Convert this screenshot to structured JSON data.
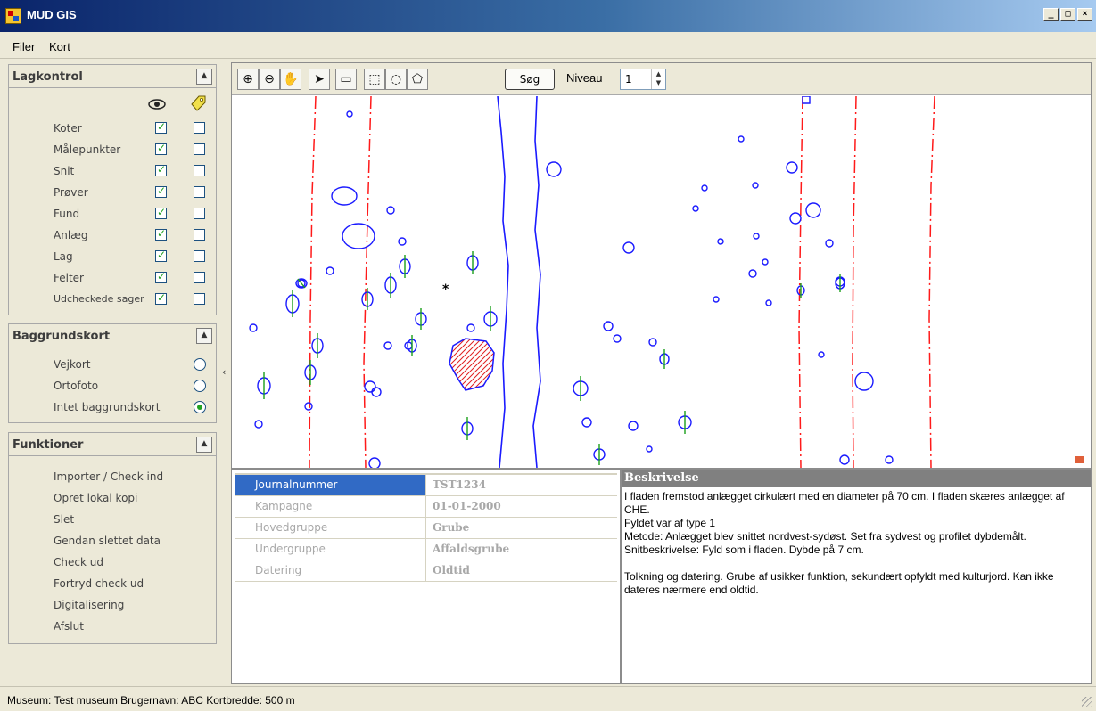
{
  "window": {
    "title": "MUD GIS",
    "buttons": [
      "_",
      "□",
      "×"
    ]
  },
  "menu": {
    "items": [
      "Filer",
      "Kort"
    ]
  },
  "layers_panel": {
    "title": "Lagkontrol",
    "col_visible_icon": "eye-icon",
    "col_label_icon": "tag-icon",
    "rows": [
      {
        "label": "Koter",
        "visible": true,
        "labels": false
      },
      {
        "label": "Målepunkter",
        "visible": true,
        "labels": false
      },
      {
        "label": "Snit",
        "visible": true,
        "labels": false
      },
      {
        "label": "Prøver",
        "visible": true,
        "labels": false
      },
      {
        "label": "Fund",
        "visible": true,
        "labels": false
      },
      {
        "label": "Anlæg",
        "visible": true,
        "labels": false
      },
      {
        "label": "Lag",
        "visible": true,
        "labels": false
      },
      {
        "label": "Felter",
        "visible": true,
        "labels": false
      },
      {
        "label": "Udcheckede sager",
        "visible": true,
        "labels": false
      }
    ]
  },
  "background_panel": {
    "title": "Baggrundskort",
    "options": [
      {
        "label": "Vejkort",
        "selected": false
      },
      {
        "label": "Ortofoto",
        "selected": false
      },
      {
        "label": "Intet baggrundskort",
        "selected": true
      }
    ]
  },
  "functions_panel": {
    "title": "Funktioner",
    "items": [
      "Importer / Check ind",
      "Opret lokal kopi",
      "Slet",
      "Gendan slettet data",
      "Check ud",
      "Fortryd check ud",
      "Digitalisering",
      "Afslut"
    ]
  },
  "toolbar": {
    "tools": [
      "zoom-in-icon",
      "zoom-out-icon",
      "pan-hand-icon",
      "select-arrow-icon",
      "measure-icon",
      "select-rect-icon",
      "select-circle-icon",
      "select-polygon-icon"
    ],
    "search_label": "Søg",
    "level_label": "Niveau",
    "level_value": "1"
  },
  "properties": [
    {
      "key": "Journalnummer",
      "value": "TST1234"
    },
    {
      "key": "Kampagne",
      "value": "01-01-2000"
    },
    {
      "key": "Hovedgruppe",
      "value": "Grube"
    },
    {
      "key": "Undergruppe",
      "value": "Affaldsgrube"
    },
    {
      "key": "Datering",
      "value": "Oldtid"
    }
  ],
  "description": {
    "title": "Beskrivelse",
    "text": "I fladen fremstod anlægget cirkulært med en diameter på 70 cm. I fladen skæres anlægget af CHE.\nFyldet var af type 1\nMetode: Anlægget blev snittet nordvest-sydøst. Set fra sydvest og profilet dybdemålt.\nSnitbeskrivelse: Fyld som i fladen. Dybde på 7 cm.\n\nTolkning og datering. Grube af usikker funktion, sekundært opfyldt med kulturjord. Kan ikke dateres nærmere end oldtid."
  },
  "status": {
    "text": "Museum: Test museum  Brugernavn: ABC  Kortbredde: 500 m"
  },
  "colors": {
    "feature": "#1a1aff",
    "boundary": "#ff1a1a",
    "section": "#1aa01a",
    "selection": "#316ac5"
  }
}
